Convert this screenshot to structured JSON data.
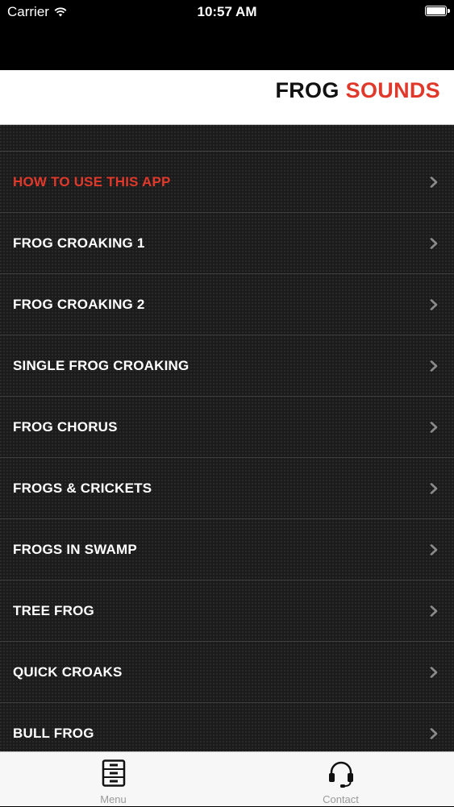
{
  "status_bar": {
    "carrier": "Carrier",
    "time": "10:57 AM"
  },
  "header": {
    "title_part1": "FROG",
    "title_part2": "SOUNDS"
  },
  "menu": {
    "items": [
      {
        "label": "HOW TO USE THIS APP"
      },
      {
        "label": "FROG CROAKING 1"
      },
      {
        "label": "FROG CROAKING 2"
      },
      {
        "label": "SINGLE FROG CROAKING"
      },
      {
        "label": "FROG CHORUS"
      },
      {
        "label": "FROGS & CRICKETS"
      },
      {
        "label": "FROGS IN SWAMP"
      },
      {
        "label": "TREE FROG"
      },
      {
        "label": "QUICK CROAKS"
      },
      {
        "label": "BULL FROG"
      }
    ]
  },
  "tab_bar": {
    "tabs": [
      {
        "label": "Menu",
        "icon": "cabinet-icon"
      },
      {
        "label": "Contact",
        "icon": "headset-icon"
      }
    ]
  },
  "colors": {
    "accent": "#e0392b",
    "menu_background": "#1b1b1b",
    "text": "#ffffff"
  }
}
